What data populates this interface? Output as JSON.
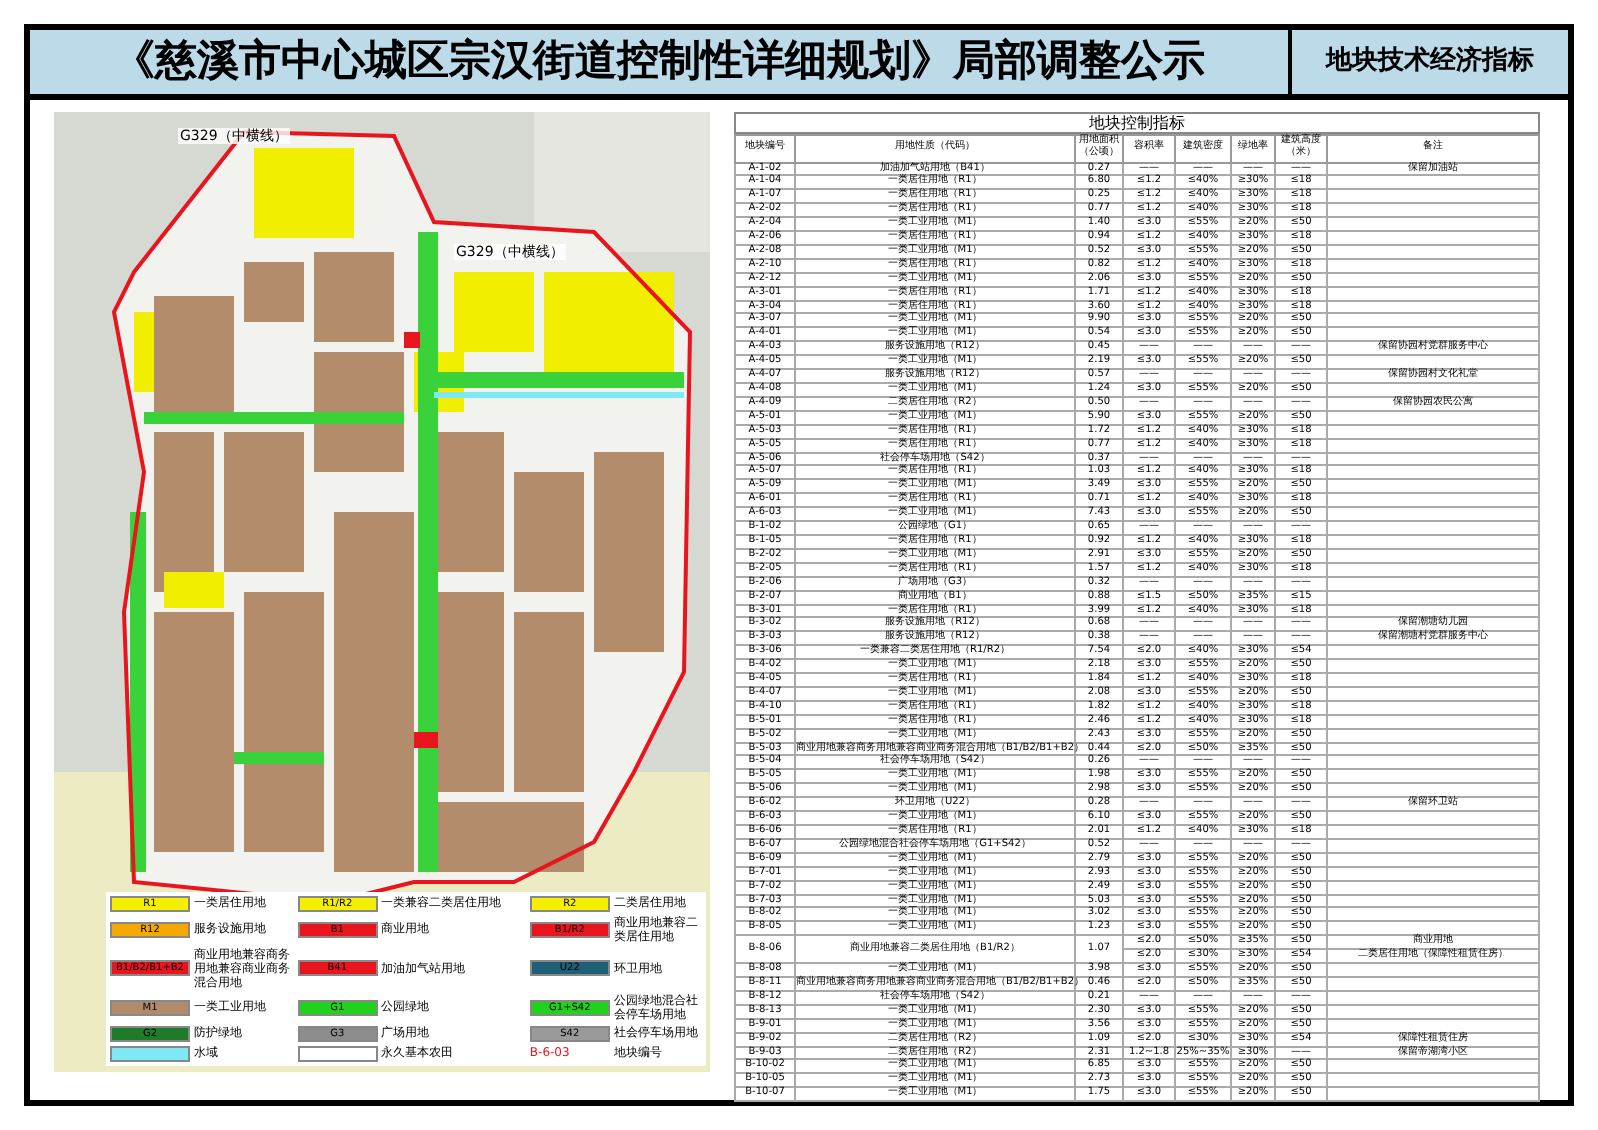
{
  "header": {
    "title": "《慈溪市中心城区宗汉街道控制性详细规划》局部调整公示",
    "section": "地块技术经济指标"
  },
  "map": {
    "road_labels": [
      "G329（中横线）",
      "G329（中横线）"
    ],
    "legend": [
      {
        "code": "R1",
        "label": "一类居住用地",
        "color": "#f5f000"
      },
      {
        "code": "R1/R2",
        "label": "一类兼容二类居住用地",
        "color": "#f5f000"
      },
      {
        "code": "R2",
        "label": "二类居住用地",
        "color": "#f5f000"
      },
      {
        "code": "R12",
        "label": "服务设施用地",
        "color": "#f5a800"
      },
      {
        "code": "B1",
        "label": "商业用地",
        "color": "#e8141e"
      },
      {
        "code": "B1/R2",
        "label": "商业用地兼容二类居住用地",
        "color": "#e8141e"
      },
      {
        "code": "B1/B2/B1+B2",
        "label": "商业用地兼容商务用地兼容商业商务混合用地",
        "color": "#e8141e"
      },
      {
        "code": "B41",
        "label": "加油加气站用地",
        "color": "#e8141e"
      },
      {
        "code": "U22",
        "label": "环卫用地",
        "color": "#1f5f78"
      },
      {
        "code": "M1",
        "label": "一类工业用地",
        "color": "#b08a6a"
      },
      {
        "code": "G1",
        "label": "公园绿地",
        "color": "#22d11e"
      },
      {
        "code": "G1+S42",
        "label": "公园绿地混合社会停车场用地",
        "color": "#22d11e"
      },
      {
        "code": "G2",
        "label": "防护绿地",
        "color": "#1f7a2a"
      },
      {
        "code": "G3",
        "label": "广场用地",
        "color": "#8c8c8c"
      },
      {
        "code": "S42",
        "label": "社会停车场用地",
        "color": "#9a9a9a"
      },
      {
        "label": "水域",
        "color": "#7fe8f5"
      },
      {
        "label": "永久基本农田",
        "color": "#ffffff"
      },
      {
        "code": "B-6-03",
        "label": "地块编号"
      }
    ]
  },
  "table": {
    "title": "地块控制指标",
    "columns": [
      "地块编号",
      "用地性质（代码）",
      "用地面积（公顷）",
      "容积率",
      "建筑密度",
      "绿地率",
      "建筑高度（米）",
      "备注"
    ],
    "rows": [
      {
        "code": "A-1-02",
        "use": "加油加气站用地（B41）",
        "area": "0.27",
        "indicators": [
          {
            "far": "——",
            "density": "——",
            "green": "——",
            "height": "——",
            "note": "保留加油站"
          }
        ]
      },
      {
        "code": "A-1-04",
        "use": "一类居住用地（R1）",
        "area": "6.80",
        "indicators": [
          {
            "far": "≤1.2",
            "density": "≤40%",
            "green": "≥30%",
            "height": "≤18"
          }
        ]
      },
      {
        "code": "A-1-07",
        "use": "一类居住用地（R1）",
        "area": "0.25",
        "indicators": [
          {
            "far": "≤1.2",
            "density": "≤40%",
            "green": "≥30%",
            "height": "≤18"
          }
        ]
      },
      {
        "code": "A-2-02",
        "use": "一类居住用地（R1）",
        "area": "0.77",
        "indicators": [
          {
            "far": "≤1.2",
            "density": "≤40%",
            "green": "≥30%",
            "height": "≤18"
          }
        ]
      },
      {
        "code": "A-2-04",
        "use": "一类工业用地（M1）",
        "area": "1.40",
        "indicators": [
          {
            "far": "≤3.0",
            "density": "≤55%",
            "green": "≥20%",
            "height": "≤50"
          }
        ]
      },
      {
        "code": "A-2-06",
        "use": "一类居住用地（R1）",
        "area": "0.94",
        "indicators": [
          {
            "far": "≤1.2",
            "density": "≤40%",
            "green": "≥30%",
            "height": "≤18"
          }
        ]
      },
      {
        "code": "A-2-08",
        "use": "一类工业用地（M1）",
        "area": "0.52",
        "indicators": [
          {
            "far": "≤3.0",
            "density": "≤55%",
            "green": "≥20%",
            "height": "≤50"
          }
        ]
      },
      {
        "code": "A-2-10",
        "use": "一类居住用地（R1）",
        "area": "0.82",
        "indicators": [
          {
            "far": "≤1.2",
            "density": "≤40%",
            "green": "≥30%",
            "height": "≤18"
          }
        ]
      },
      {
        "code": "A-2-12",
        "use": "一类工业用地（M1）",
        "area": "2.06",
        "indicators": [
          {
            "far": "≤3.0",
            "density": "≤55%",
            "green": "≥20%",
            "height": "≤50"
          }
        ]
      },
      {
        "code": "A-3-01",
        "use": "一类居住用地（R1）",
        "area": "1.71",
        "indicators": [
          {
            "far": "≤1.2",
            "density": "≤40%",
            "green": "≥30%",
            "height": "≤18"
          }
        ]
      },
      {
        "code": "A-3-04",
        "use": "一类居住用地（R1）",
        "area": "3.60",
        "indicators": [
          {
            "far": "≤1.2",
            "density": "≤40%",
            "green": "≥30%",
            "height": "≤18"
          }
        ]
      },
      {
        "code": "A-3-07",
        "use": "一类工业用地（M1）",
        "area": "9.90",
        "indicators": [
          {
            "far": "≤3.0",
            "density": "≤55%",
            "green": "≥20%",
            "height": "≤50"
          }
        ]
      },
      {
        "code": "A-4-01",
        "use": "一类工业用地（M1）",
        "area": "0.54",
        "indicators": [
          {
            "far": "≤3.0",
            "density": "≤55%",
            "green": "≥20%",
            "height": "≤50"
          }
        ]
      },
      {
        "code": "A-4-03",
        "use": "服务设施用地（R12）",
        "area": "0.45",
        "indicators": [
          {
            "far": "——",
            "density": "——",
            "green": "——",
            "height": "——",
            "note": "保留协园村党群服务中心"
          }
        ]
      },
      {
        "code": "A-4-05",
        "use": "一类工业用地（M1）",
        "area": "2.19",
        "indicators": [
          {
            "far": "≤3.0",
            "density": "≤55%",
            "green": "≥20%",
            "height": "≤50"
          }
        ]
      },
      {
        "code": "A-4-07",
        "use": "服务设施用地（R12）",
        "area": "0.57",
        "indicators": [
          {
            "far": "——",
            "density": "——",
            "green": "——",
            "height": "——",
            "note": "保留协园村文化礼堂"
          }
        ]
      },
      {
        "code": "A-4-08",
        "use": "一类工业用地（M1）",
        "area": "1.24",
        "indicators": [
          {
            "far": "≤3.0",
            "density": "≤55%",
            "green": "≥20%",
            "height": "≤50"
          }
        ]
      },
      {
        "code": "A-4-09",
        "use": "二类居住用地（R2）",
        "area": "0.50",
        "indicators": [
          {
            "far": "——",
            "density": "——",
            "green": "——",
            "height": "——",
            "note": "保留协园农民公寓"
          }
        ]
      },
      {
        "code": "A-5-01",
        "use": "一类工业用地（M1）",
        "area": "5.90",
        "indicators": [
          {
            "far": "≤3.0",
            "density": "≤55%",
            "green": "≥20%",
            "height": "≤50"
          }
        ]
      },
      {
        "code": "A-5-03",
        "use": "一类居住用地（R1）",
        "area": "1.72",
        "indicators": [
          {
            "far": "≤1.2",
            "density": "≤40%",
            "green": "≥30%",
            "height": "≤18"
          }
        ]
      },
      {
        "code": "A-5-05",
        "use": "一类居住用地（R1）",
        "area": "0.77",
        "indicators": [
          {
            "far": "≤1.2",
            "density": "≤40%",
            "green": "≥30%",
            "height": "≤18"
          }
        ]
      },
      {
        "code": "A-5-06",
        "use": "社会停车场用地（S42）",
        "area": "0.37",
        "indicators": [
          {
            "far": "——",
            "density": "——",
            "green": "——",
            "height": "——"
          }
        ]
      },
      {
        "code": "A-5-07",
        "use": "一类居住用地（R1）",
        "area": "1.03",
        "indicators": [
          {
            "far": "≤1.2",
            "density": "≤40%",
            "green": "≥30%",
            "height": "≤18"
          }
        ]
      },
      {
        "code": "A-5-09",
        "use": "一类工业用地（M1）",
        "area": "3.49",
        "indicators": [
          {
            "far": "≤3.0",
            "density": "≤55%",
            "green": "≥20%",
            "height": "≤50"
          }
        ]
      },
      {
        "code": "A-6-01",
        "use": "一类居住用地（R1）",
        "area": "0.71",
        "indicators": [
          {
            "far": "≤1.2",
            "density": "≤40%",
            "green": "≥30%",
            "height": "≤18"
          }
        ]
      },
      {
        "code": "A-6-03",
        "use": "一类工业用地（M1）",
        "area": "7.43",
        "indicators": [
          {
            "far": "≤3.0",
            "density": "≤55%",
            "green": "≥20%",
            "height": "≤50"
          }
        ]
      },
      {
        "code": "B-1-02",
        "use": "公园绿地（G1）",
        "area": "0.65",
        "indicators": [
          {
            "far": "——",
            "density": "——",
            "green": "——",
            "height": "——"
          }
        ]
      },
      {
        "code": "B-1-05",
        "use": "一类居住用地（R1）",
        "area": "0.92",
        "indicators": [
          {
            "far": "≤1.2",
            "density": "≤40%",
            "green": "≥30%",
            "height": "≤18"
          }
        ]
      },
      {
        "code": "B-2-02",
        "use": "一类工业用地（M1）",
        "area": "2.91",
        "indicators": [
          {
            "far": "≤3.0",
            "density": "≤55%",
            "green": "≥20%",
            "height": "≤50"
          }
        ]
      },
      {
        "code": "B-2-05",
        "use": "一类居住用地（R1）",
        "area": "1.57",
        "indicators": [
          {
            "far": "≤1.2",
            "density": "≤40%",
            "green": "≥30%",
            "height": "≤18"
          }
        ]
      },
      {
        "code": "B-2-06",
        "use": "广场用地（G3）",
        "area": "0.32",
        "indicators": [
          {
            "far": "——",
            "density": "——",
            "green": "——",
            "height": "——"
          }
        ]
      },
      {
        "code": "B-2-07",
        "use": "商业用地（B1）",
        "area": "0.88",
        "indicators": [
          {
            "far": "≤1.5",
            "density": "≤50%",
            "green": "≥35%",
            "height": "≤15"
          }
        ]
      },
      {
        "code": "B-3-01",
        "use": "一类居住用地（R1）",
        "area": "3.99",
        "indicators": [
          {
            "far": "≤1.2",
            "density": "≤40%",
            "green": "≥30%",
            "height": "≤18"
          }
        ]
      },
      {
        "code": "B-3-02",
        "use": "服务设施用地（R12）",
        "area": "0.68",
        "indicators": [
          {
            "far": "——",
            "density": "——",
            "green": "——",
            "height": "——",
            "note": "保留潮塘幼儿园"
          }
        ]
      },
      {
        "code": "B-3-03",
        "use": "服务设施用地（R12）",
        "area": "0.38",
        "indicators": [
          {
            "far": "——",
            "density": "——",
            "green": "——",
            "height": "——",
            "note": "保留潮塘村党群服务中心"
          }
        ]
      },
      {
        "code": "B-3-06",
        "use": "一类兼容二类居住用地（R1/R2）",
        "area": "7.54",
        "indicators": [
          {
            "far": "≤2.0",
            "density": "≤40%",
            "green": "≥30%",
            "height": "≤54"
          }
        ]
      },
      {
        "code": "B-4-02",
        "use": "一类工业用地（M1）",
        "area": "2.18",
        "indicators": [
          {
            "far": "≤3.0",
            "density": "≤55%",
            "green": "≥20%",
            "height": "≤50"
          }
        ]
      },
      {
        "code": "B-4-05",
        "use": "一类居住用地（R1）",
        "area": "1.84",
        "indicators": [
          {
            "far": "≤1.2",
            "density": "≤40%",
            "green": "≥30%",
            "height": "≤18"
          }
        ]
      },
      {
        "code": "B-4-07",
        "use": "一类工业用地（M1）",
        "area": "2.08",
        "indicators": [
          {
            "far": "≤3.0",
            "density": "≤55%",
            "green": "≥20%",
            "height": "≤50"
          }
        ]
      },
      {
        "code": "B-4-10",
        "use": "一类居住用地（R1）",
        "area": "1.82",
        "indicators": [
          {
            "far": "≤1.2",
            "density": "≤40%",
            "green": "≥30%",
            "height": "≤18"
          }
        ]
      },
      {
        "code": "B-5-01",
        "use": "一类居住用地（R1）",
        "area": "2.46",
        "indicators": [
          {
            "far": "≤1.2",
            "density": "≤40%",
            "green": "≥30%",
            "height": "≤18"
          }
        ]
      },
      {
        "code": "B-5-02",
        "use": "一类工业用地（M1）",
        "area": "2.43",
        "indicators": [
          {
            "far": "≤3.0",
            "density": "≤55%",
            "green": "≥20%",
            "height": "≤50"
          }
        ]
      },
      {
        "code": "B-5-03",
        "use": "商业用地兼容商务用地兼容商业商务混合用地（B1/B2/B1+B2）",
        "area": "0.44",
        "indicators": [
          {
            "far": "≤2.0",
            "density": "≤50%",
            "green": "≥35%",
            "height": "≤50"
          }
        ]
      },
      {
        "code": "B-5-04",
        "use": "社会停车场用地（S42）",
        "area": "0.26",
        "indicators": [
          {
            "far": "——",
            "density": "——",
            "green": "——",
            "height": "——"
          }
        ]
      },
      {
        "code": "B-5-05",
        "use": "一类工业用地（M1）",
        "area": "1.98",
        "indicators": [
          {
            "far": "≤3.0",
            "density": "≤55%",
            "green": "≥20%",
            "height": "≤50"
          }
        ]
      },
      {
        "code": "B-5-06",
        "use": "一类工业用地（M1）",
        "area": "2.98",
        "indicators": [
          {
            "far": "≤3.0",
            "density": "≤55%",
            "green": "≥20%",
            "height": "≤50"
          }
        ]
      },
      {
        "code": "B-6-02",
        "use": "环卫用地（U22）",
        "area": "0.28",
        "indicators": [
          {
            "far": "——",
            "density": "——",
            "green": "——",
            "height": "——",
            "note": "保留环卫站"
          }
        ]
      },
      {
        "code": "B-6-03",
        "use": "一类工业用地（M1）",
        "area": "6.10",
        "indicators": [
          {
            "far": "≤3.0",
            "density": "≤55%",
            "green": "≥20%",
            "height": "≤50"
          }
        ]
      },
      {
        "code": "B-6-06",
        "use": "一类居住用地（R1）",
        "area": "2.01",
        "indicators": [
          {
            "far": "≤1.2",
            "density": "≤40%",
            "green": "≥30%",
            "height": "≤18"
          }
        ]
      },
      {
        "code": "B-6-07",
        "use": "公园绿地混合社会停车场用地（G1+S42）",
        "area": "0.52",
        "indicators": [
          {
            "far": "——",
            "density": "——",
            "green": "——",
            "height": "——"
          }
        ]
      },
      {
        "code": "B-6-09",
        "use": "一类工业用地（M1）",
        "area": "2.79",
        "indicators": [
          {
            "far": "≤3.0",
            "density": "≤55%",
            "green": "≥20%",
            "height": "≤50"
          }
        ]
      },
      {
        "code": "B-7-01",
        "use": "一类工业用地（M1）",
        "area": "2.93",
        "indicators": [
          {
            "far": "≤3.0",
            "density": "≤55%",
            "green": "≥20%",
            "height": "≤50"
          }
        ]
      },
      {
        "code": "B-7-02",
        "use": "一类工业用地（M1）",
        "area": "2.49",
        "indicators": [
          {
            "far": "≤3.0",
            "density": "≤55%",
            "green": "≥20%",
            "height": "≤50"
          }
        ]
      },
      {
        "code": "B-7-03",
        "use": "一类工业用地（M1）",
        "area": "5.03",
        "indicators": [
          {
            "far": "≤3.0",
            "density": "≤55%",
            "green": "≥20%",
            "height": "≤50"
          }
        ]
      },
      {
        "code": "B-8-02",
        "use": "一类工业用地（M1）",
        "area": "3.02",
        "indicators": [
          {
            "far": "≤3.0",
            "density": "≤55%",
            "green": "≥20%",
            "height": "≤50"
          }
        ]
      },
      {
        "code": "B-8-05",
        "use": "一类工业用地（M1）",
        "area": "1.23",
        "indicators": [
          {
            "far": "≤3.0",
            "density": "≤55%",
            "green": "≥20%",
            "height": "≤50"
          }
        ]
      },
      {
        "code": "B-8-06",
        "use": "商业用地兼容二类居住用地（B1/R2）",
        "area": "1.07",
        "indicators": [
          {
            "far": "≤2.0",
            "density": "≤50%",
            "green": "≥35%",
            "height": "≤50",
            "note": "商业用地"
          },
          {
            "far": "≤2.0",
            "density": "≤30%",
            "green": "≥30%",
            "height": "≤54",
            "note": "二类居住用地（保障性租赁住房）"
          }
        ]
      },
      {
        "code": "B-8-08",
        "use": "一类工业用地（M1）",
        "area": "3.98",
        "indicators": [
          {
            "far": "≤3.0",
            "density": "≤55%",
            "green": "≥20%",
            "height": "≤50"
          }
        ]
      },
      {
        "code": "B-8-11",
        "use": "商业用地兼容商务用地兼容商业商务混合用地（B1/B2/B1+B2）",
        "area": "0.46",
        "indicators": [
          {
            "far": "≤2.0",
            "density": "≤50%",
            "green": "≥35%",
            "height": "≤50"
          }
        ]
      },
      {
        "code": "B-8-12",
        "use": "社会停车场用地（S42）",
        "area": "0.21",
        "indicators": [
          {
            "far": "——",
            "density": "——",
            "green": "——",
            "height": "——"
          }
        ]
      },
      {
        "code": "B-8-13",
        "use": "一类工业用地（M1）",
        "area": "2.30",
        "indicators": [
          {
            "far": "≤3.0",
            "density": "≤55%",
            "green": "≥20%",
            "height": "≤50"
          }
        ]
      },
      {
        "code": "B-9-01",
        "use": "一类工业用地（M1）",
        "area": "3.56",
        "indicators": [
          {
            "far": "≤3.0",
            "density": "≤55%",
            "green": "≥20%",
            "height": "≤50"
          }
        ]
      },
      {
        "code": "B-9-02",
        "use": "二类居住用地（R2）",
        "area": "1.09",
        "indicators": [
          {
            "far": "≤2.0",
            "density": "≤30%",
            "green": "≥30%",
            "height": "≤54",
            "note": "保障性租赁住房"
          }
        ]
      },
      {
        "code": "B-9-03",
        "use": "二类居住用地（R2）",
        "area": "2.31",
        "indicators": [
          {
            "far": "1.2~1.8",
            "density": "25%~35%",
            "green": "≥30%",
            "height": "——",
            "note": "保留帝湖湾小区"
          }
        ]
      },
      {
        "code": "B-10-02",
        "use": "一类工业用地（M1）",
        "area": "6.85",
        "indicators": [
          {
            "far": "≤3.0",
            "density": "≤55%",
            "green": "≥20%",
            "height": "≤50"
          }
        ]
      },
      {
        "code": "B-10-05",
        "use": "一类工业用地（M1）",
        "area": "2.73",
        "indicators": [
          {
            "far": "≤3.0",
            "density": "≤55%",
            "green": "≥20%",
            "height": "≤50"
          }
        ]
      },
      {
        "code": "B-10-07",
        "use": "一类工业用地（M1）",
        "area": "1.75",
        "indicators": [
          {
            "far": "≤3.0",
            "density": "≤55%",
            "green": "≥20%",
            "height": "≤50"
          }
        ]
      }
    ]
  }
}
